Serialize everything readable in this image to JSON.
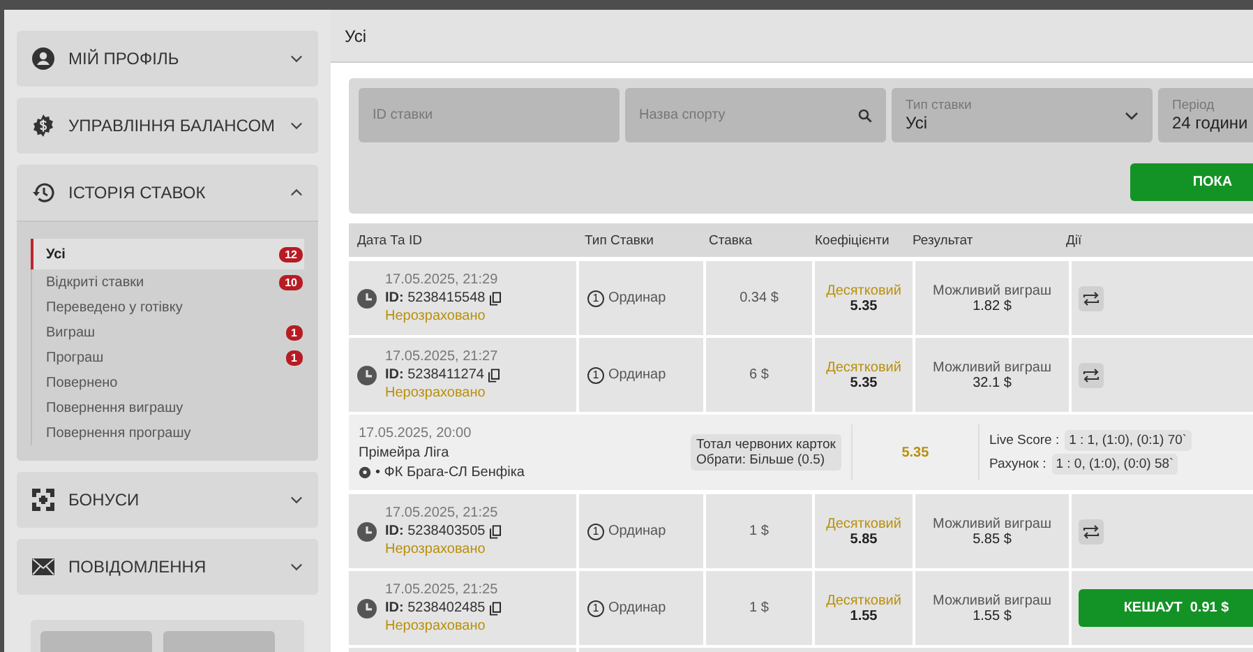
{
  "sidebar": {
    "sections": [
      {
        "title": "МІЙ ПРОФІЛЬ",
        "expanded": false
      },
      {
        "title": "УПРАВЛІННЯ БАЛАНСОМ",
        "expanded": false
      },
      {
        "title": "ІСТОРІЯ СТАВОК",
        "expanded": true,
        "items": [
          {
            "label": "Усі",
            "count": "12",
            "selected": true
          },
          {
            "label": "Відкриті ставки",
            "count": "10",
            "selected": false
          },
          {
            "label": "Переведено у готівку",
            "selected": false
          },
          {
            "label": "Виграш",
            "count": "1",
            "selected": false
          },
          {
            "label": "Програш",
            "count": "1",
            "selected": false
          },
          {
            "label": "Повернено",
            "selected": false
          },
          {
            "label": "Повернення виграшу",
            "selected": false
          },
          {
            "label": "Повернення програшу",
            "selected": false
          }
        ]
      },
      {
        "title": "БОНУСИ",
        "expanded": false
      },
      {
        "title": "ПОВІДОМЛЕННЯ",
        "expanded": false
      }
    ]
  },
  "page_title": "Усі",
  "filters": {
    "bet_id": {
      "placeholder": "ID ставки"
    },
    "sport": {
      "placeholder": "Назва спорту"
    },
    "bet_type": {
      "label": "Тип ставки",
      "value": "Усі"
    },
    "period": {
      "label": "Період",
      "value": "24 години"
    },
    "show_button": "ПОКА"
  },
  "table": {
    "columns": [
      "Дата Та ID",
      "Тип Ставки",
      "Ставка",
      "Коефіцієнти",
      "Результат",
      "Дії"
    ],
    "rows": [
      {
        "kind": "bet",
        "date": "17.05.2025, 21:29",
        "id_label": "ID:",
        "id": "5238415548",
        "status": "Нерозраховано",
        "type_no": "1",
        "type": "Ординар",
        "stake": "0.34 $",
        "odds_type": "Десятковий",
        "odds": "5.35",
        "result_label": "Можливий виграш",
        "result": "1.82 $"
      },
      {
        "kind": "bet",
        "date": "17.05.2025, 21:27",
        "id_label": "ID:",
        "id": "5238411274",
        "status": "Нерозраховано",
        "type_no": "1",
        "type": "Ординар",
        "stake": "6 $",
        "odds_type": "Десятковий",
        "odds": "5.35",
        "result_label": "Можливий виграш",
        "result": "32.1 $"
      },
      {
        "kind": "detail",
        "date": "17.05.2025, 20:00",
        "league": "Прімейра Ліга",
        "match": "• ФК Брага-СЛ Бенфіка",
        "market": "Тотал червоних карток",
        "pick": "Обрати: Більше (0.5)",
        "odds": "5.35",
        "scores": [
          {
            "label": "Live Score :",
            "value": "1 : 1, (1:0), (0:1) 70`"
          },
          {
            "label": "Рахунок :",
            "value": "1 : 0, (1:0), (0:0) 58`"
          }
        ]
      },
      {
        "kind": "bet",
        "date": "17.05.2025, 21:25",
        "id_label": "ID:",
        "id": "5238403505",
        "status": "Нерозраховано",
        "type_no": "1",
        "type": "Ординар",
        "stake": "1 $",
        "odds_type": "Десятковий",
        "odds": "5.85",
        "result_label": "Можливий виграш",
        "result": "5.85 $"
      },
      {
        "kind": "bet",
        "date": "17.05.2025, 21:25",
        "id_label": "ID:",
        "id": "5238402485",
        "status": "Нерозраховано",
        "type_no": "1",
        "type": "Ординар",
        "stake": "1 $",
        "odds_type": "Десятковий",
        "odds": "1.55",
        "result_label": "Можливий виграш",
        "result": "1.55 $",
        "cashout_label": "КЕШАУТ",
        "cashout_value": "0.91 $"
      }
    ]
  }
}
